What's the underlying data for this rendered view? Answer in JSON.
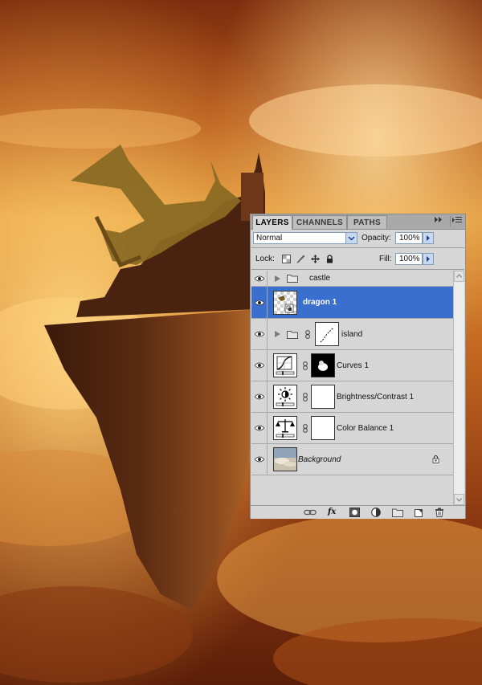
{
  "panel": {
    "tabs": [
      {
        "label": "LAYERS",
        "active": true
      },
      {
        "label": "CHANNELS",
        "active": false
      },
      {
        "label": "PATHS",
        "active": false
      }
    ],
    "collapse_icon": "double-right-arrow-icon",
    "menu_icon": "panel-menu-icon",
    "blend_mode": "Normal",
    "opacity_label": "Opacity:",
    "opacity_value": "100%",
    "lock_label": "Lock:",
    "fill_label": "Fill:",
    "fill_value": "100%",
    "lock_icons": [
      "lock-transparent-icon",
      "lock-image-icon",
      "lock-position-icon",
      "lock-all-icon"
    ],
    "layers": [
      {
        "name": "castle",
        "type": "group",
        "visible": true,
        "selected": false
      },
      {
        "name": "dragon 1",
        "type": "smart-object",
        "visible": true,
        "selected": true
      },
      {
        "name": "island",
        "type": "group-with-mask",
        "visible": true,
        "selected": false
      },
      {
        "name": "Curves 1",
        "type": "adjustment-curves",
        "visible": true,
        "selected": false
      },
      {
        "name": "Brightness/Contrast 1",
        "type": "adjustment-brightness",
        "visible": true,
        "selected": false
      },
      {
        "name": "Color Balance 1",
        "type": "adjustment-color-balance",
        "visible": true,
        "selected": false
      },
      {
        "name": "Background",
        "type": "background",
        "visible": true,
        "selected": false,
        "locked": true
      }
    ],
    "footer_icons": [
      "link-layers-icon",
      "fx-icon",
      "add-mask-icon",
      "adjustment-layer-icon",
      "new-group-icon",
      "new-layer-icon",
      "trash-icon"
    ],
    "footer_fx_label": "fx"
  },
  "colors": {
    "panel_bg": "#d6d6d6",
    "selection": "#3a6fce",
    "tab_bar": "#a9a9a9"
  }
}
